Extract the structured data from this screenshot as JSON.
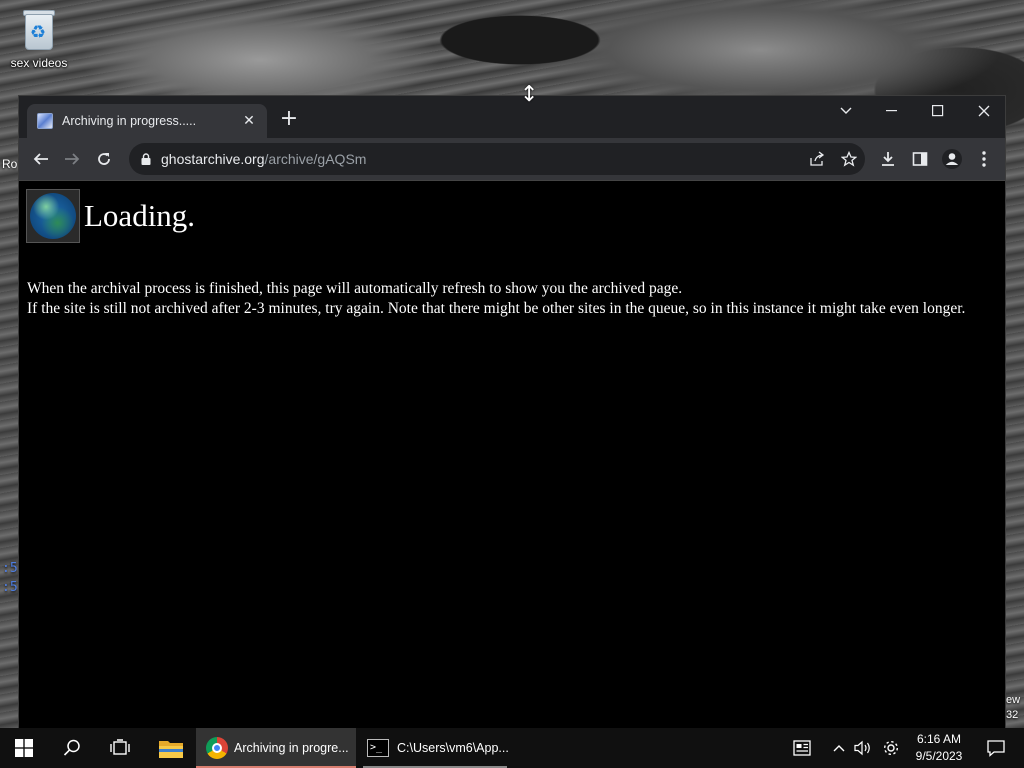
{
  "desktop": {
    "recycle_bin_label": "sex videos",
    "edge_left_top": "Ro",
    "edge_left_mid1": ":53",
    "edge_left_mid2": ":53",
    "edge_right_bottom1": "ew",
    "edge_right_bottom2": "32"
  },
  "browser": {
    "tab": {
      "title": "Archiving in progress.....",
      "favicon": "archive-favicon"
    },
    "window_controls": [
      "tab-search-icon",
      "minimize-icon",
      "maximize-icon",
      "close-icon"
    ],
    "address": {
      "host": "ghostarchive.org",
      "path": "/archive/gAQSm"
    },
    "toolbar_icons": [
      "back-icon",
      "forward-icon",
      "reload-icon",
      "lock-icon",
      "share-icon",
      "star-icon",
      "download-icon",
      "side-panel-icon",
      "profile-icon",
      "menu-icon"
    ]
  },
  "page": {
    "heading": "Loading.",
    "line1": "When the archival process is finished, this page will automatically refresh to show you the archived page.",
    "line2": "If the site is still not archived after 2-3 minutes, try again. Note that there might be other sites in the queue, so in this instance it might take even longer."
  },
  "taskbar": {
    "items": [
      {
        "label": "Archiving in progre...",
        "icon": "chrome-icon",
        "active": true
      },
      {
        "label": "C:\\Users\\vm6\\App...",
        "icon": "terminal-icon",
        "active": false
      }
    ],
    "clock": {
      "time": "6:16 AM",
      "date": "9/5/2023"
    },
    "icons": [
      "start-icon",
      "search-icon",
      "task-view-icon",
      "file-explorer-icon",
      "news-icon",
      "chevron-up-icon",
      "volume-icon",
      "settings-icon",
      "notifications-icon"
    ]
  }
}
